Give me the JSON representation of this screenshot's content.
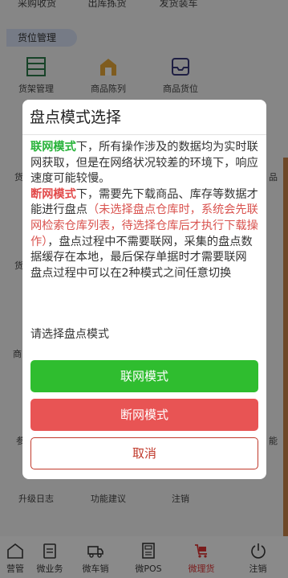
{
  "top_tabs": [
    "采购收货",
    "出库拣货",
    "发货装车"
  ],
  "section_shelf": "货位管理",
  "shelf_items": [
    "货架管理",
    "商品陈列",
    "商品货位"
  ],
  "fragments": {
    "left1": "货",
    "left2": "货",
    "left3": "商",
    "left4": "参",
    "right1": "品",
    "right2": "能"
  },
  "bottom_items": [
    "升级日志",
    "功能建议",
    "注销"
  ],
  "tabs": [
    {
      "label": "营管",
      "icon": "home-icon"
    },
    {
      "label": "微业务",
      "icon": "clipboard-icon"
    },
    {
      "label": "微车销",
      "icon": "truck-icon"
    },
    {
      "label": "微POS",
      "icon": "pos-icon"
    },
    {
      "label": "微理货",
      "icon": "cart-icon",
      "active": true
    },
    {
      "label": "注销",
      "icon": "power-icon"
    }
  ],
  "dialog": {
    "title": "盘点模式选择",
    "online_label": "联网模式",
    "online_desc": "下，所有操作涉及的数据均为实时联网获取，但是在网络状况较差的环境下，响应速度可能较慢。",
    "offline_label": "断网模式",
    "offline_desc1": "下，需要先下载商品、库存等数据才能进行盘点",
    "offline_note": "（未选择盘点仓库时，系统会先联网检索仓库列表，待选择仓库后才执行下载操作）",
    "offline_desc2": "，盘点过程中不需要联网，采集的盘点数据缓存在本地，最后保存单据时才需要联网",
    "switch_note": "盘点过程中可以在2种模式之间任意切换",
    "prompt": "请选择盘点模式",
    "btn_online": "联网模式",
    "btn_offline": "断网模式",
    "btn_cancel": "取消"
  },
  "colors": {
    "green": "#2fbd2f",
    "red": "#e85454",
    "cancel_border": "#c0392b",
    "active_tab": "#7a1c1c"
  }
}
